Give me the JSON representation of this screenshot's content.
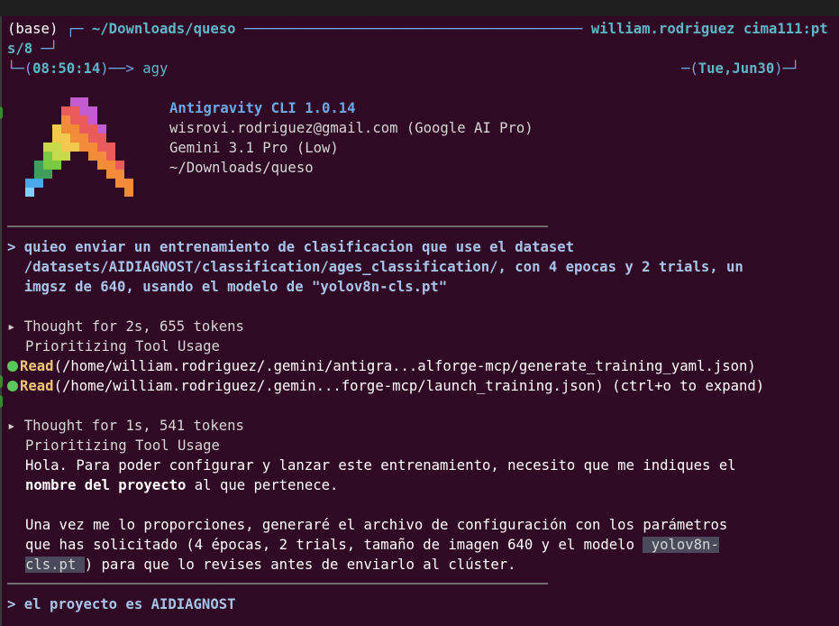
{
  "header": {
    "env": "(base)",
    "cwd": "~/Downloads/queso",
    "host_a": "william.rodriguez cima111:pt",
    "host_b": "s/8",
    "time": "08:50:14",
    "cmd": "agy",
    "date": "Tue,Jun30"
  },
  "app": {
    "name_version": "Antigravity CLI 1.0.14",
    "account": "wisrovi.rodriguez@gmail.com (Google AI Pro)",
    "model": "Gemini 3.1 Pro (Low)",
    "dir": "~/Downloads/queso"
  },
  "conversation": {
    "prompt1": [
      "> quieo enviar un entrenamiento de clasificacion que use el dataset",
      "  /datasets/AIDIAGNOST/classification/ages_classification/, con 4 epocas y 2 trials, un",
      "  imgsz de 640, usando el modelo de \"yolov8n-cls.pt\""
    ],
    "thought1": "Thought for 2s, 655 tokens",
    "thought1_sub": "Prioritizing Tool Usage",
    "tool1_name": "Read",
    "tool1_args": "(/home/william.rodriguez/.gemini/antigra...alforge-mcp/generate_training_yaml.json)",
    "tool2_name": "Read",
    "tool2_args": "(/home/william.rodriguez/.gemin...forge-mcp/launch_training.json) (ctrl+o to expand)",
    "thought2": "Thought for 1s, 541 tokens",
    "thought2_sub": "Prioritizing Tool Usage",
    "reply_l1": "Hola. Para poder configurar y lanzar este entrenamiento, necesito que me indiques el",
    "reply_l2_bold": "nombre del proyecto",
    "reply_l2_rest": " al que pertenece.",
    "reply_l3": "Una vez me lo proporciones, generaré el archivo de configuración con los parámetros",
    "reply_l4_pre": "que has solicitado (4 épocas, 2 trials, tamaño de imagen 640 y el modelo ",
    "reply_l4_code": " yolov8n-",
    "reply_l5_code": "cls.pt ",
    "reply_l5_rest": ") para que lo revises antes de enviarlo al clúster.",
    "prompt2": "> el proyecto es AIDIAGNOST"
  },
  "colors": {
    "background": "#300a24",
    "accent_cyan": "#6ca8e8",
    "tool_green": "#5cc85c"
  }
}
